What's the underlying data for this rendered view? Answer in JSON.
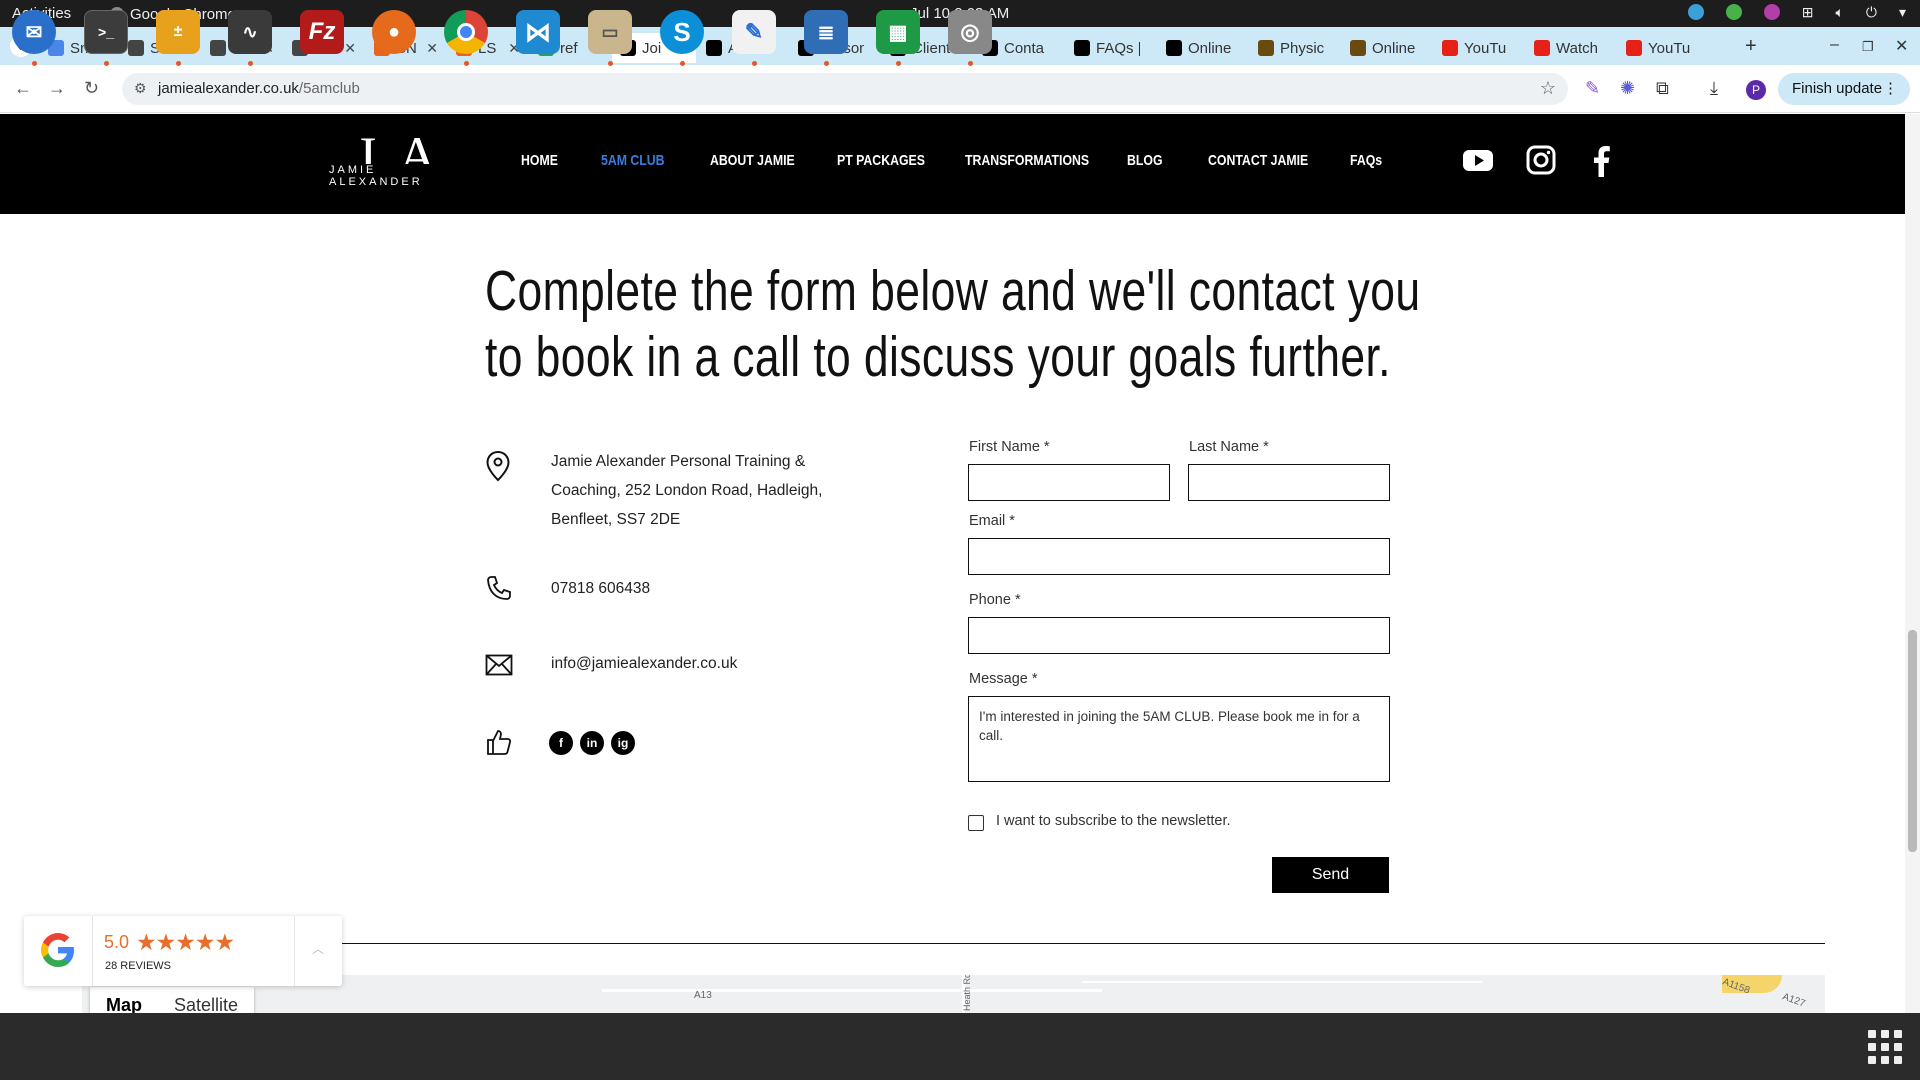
{
  "system": {
    "activities": "Activities",
    "app_name": "Google Chrome",
    "clock": "Jul 10  2:03 AM"
  },
  "browser": {
    "tabs": [
      {
        "label": "Sni",
        "color": "#4a86e8"
      },
      {
        "label": "SN",
        "color": "#444444"
      },
      {
        "label": "SN",
        "color": "#444444"
      },
      {
        "label": "SN",
        "color": "#444444"
      },
      {
        "label": "SN",
        "color": "#e8651e"
      },
      {
        "label": "LS",
        "color": "#e8651e"
      },
      {
        "label": "ref",
        "color": "#1ea362"
      },
      {
        "label": "Joi",
        "color": "#000000",
        "active": true
      },
      {
        "label": "About",
        "color": "#000000"
      },
      {
        "label": "Person",
        "color": "#000000"
      },
      {
        "label": "Client",
        "color": "#000000"
      },
      {
        "label": "Conta",
        "color": "#000000"
      },
      {
        "label": "FAQs |",
        "color": "#000000"
      },
      {
        "label": "Online",
        "color": "#000000"
      },
      {
        "label": "Physic",
        "color": "#6b4a10"
      },
      {
        "label": "Online",
        "color": "#6b4a10"
      },
      {
        "label": "YouTu",
        "color": "#e62117"
      },
      {
        "label": "Watch",
        "color": "#e62117"
      },
      {
        "label": "YouTu",
        "color": "#e62117"
      }
    ],
    "url_domain": "jamiealexander.co.uk",
    "url_path": "/5amclub",
    "finish_update": "Finish update",
    "profile_initial": "P"
  },
  "site": {
    "logo_big": "JA",
    "logo_small": "JAMIE ALEXANDER",
    "nav": [
      {
        "label": "HOME"
      },
      {
        "label": "5AM CLUB",
        "active": true
      },
      {
        "label": "ABOUT JAMIE"
      },
      {
        "label": "PT PACKAGES"
      },
      {
        "label": "TRANSFORMATIONS"
      },
      {
        "label": "BLOG"
      },
      {
        "label": "CONTACT JAMIE"
      },
      {
        "label": "FAQs"
      }
    ]
  },
  "content": {
    "headline": "Complete the form below and we'll contact you to book in a call to discuss your goals further.",
    "address": "Jamie Alexander Personal Training & Coaching, 252 London Road, Hadleigh, Benfleet, SS7 2DE",
    "phone": "07818 606438",
    "email": "info@jamiealexander.co.uk",
    "social_labels": [
      "f",
      "in",
      "ig"
    ]
  },
  "form": {
    "first_name_label": "First Name *",
    "last_name_label": "Last Name *",
    "email_label": "Email *",
    "phone_label": "Phone *",
    "message_label": "Message *",
    "message_value": "I'm interested in joining the 5AM CLUB. Please book me in for a call.",
    "newsletter_label": "I want to subscribe to the newsletter.",
    "send_label": "Send"
  },
  "map": {
    "tab_map": "Map",
    "tab_satellite": "Satellite",
    "road_a13": "A13",
    "road_heath": "Heath Rd",
    "road_a1158": "A1158",
    "road_a127": "A127"
  },
  "reviews": {
    "score": "5.0",
    "stars": "★★★★★",
    "count": "28 REVIEWS",
    "star_color": "#e76f2b"
  }
}
